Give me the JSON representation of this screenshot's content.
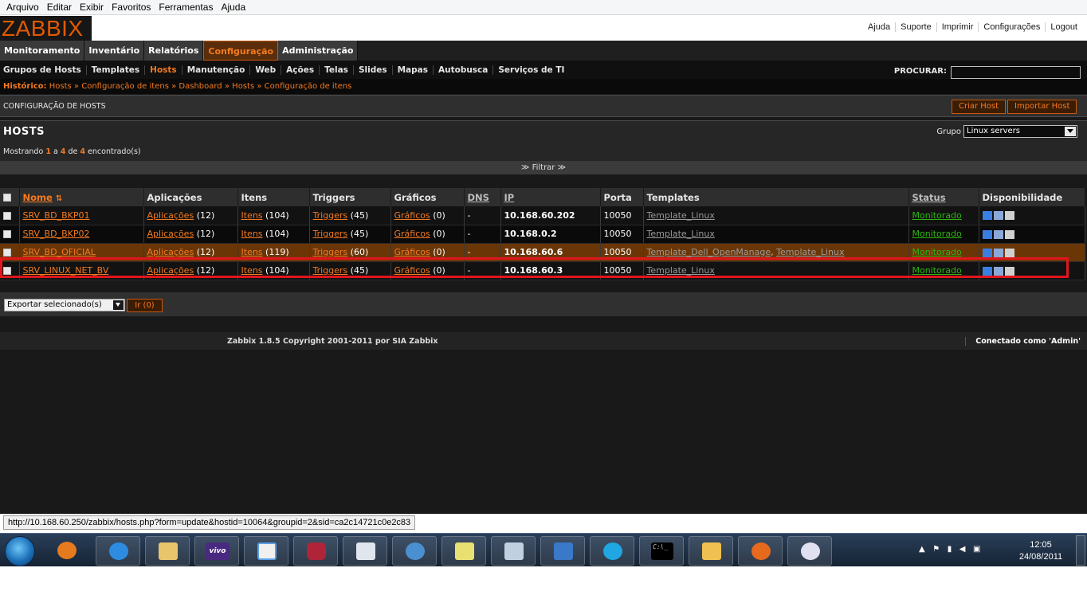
{
  "browser": {
    "menu": [
      "Arquivo",
      "Editar",
      "Exibir",
      "Favoritos",
      "Ferramentas",
      "Ajuda"
    ],
    "status_url": "http://10.168.60.250/zabbix/hosts.php?form=update&hostid=10064&groupid=2&sid=ca2c14721c0e2c83"
  },
  "header": {
    "logo": "ZABBIX",
    "links": [
      "Ajuda",
      "Suporte",
      "Imprimir",
      "Configurações",
      "Logout"
    ]
  },
  "main_menu": [
    {
      "label": "Monitoramento",
      "active": false
    },
    {
      "label": "Inventário",
      "active": false
    },
    {
      "label": "Relatórios",
      "active": false
    },
    {
      "label": "Configuração",
      "active": true
    },
    {
      "label": "Administração",
      "active": false
    }
  ],
  "sub_menu": [
    {
      "label": "Grupos de Hosts",
      "active": false
    },
    {
      "label": "Templates",
      "active": false
    },
    {
      "label": "Hosts",
      "active": true
    },
    {
      "label": "Manutenção",
      "active": false
    },
    {
      "label": "Web",
      "active": false
    },
    {
      "label": "Ações",
      "active": false
    },
    {
      "label": "Telas",
      "active": false
    },
    {
      "label": "Slides",
      "active": false
    },
    {
      "label": "Mapas",
      "active": false
    },
    {
      "label": "Autobusca",
      "active": false
    },
    {
      "label": "Serviços de TI",
      "active": false
    }
  ],
  "search": {
    "label": "PROCURAR:",
    "value": ""
  },
  "history": {
    "label": "Histórico:",
    "items": [
      "Hosts",
      "Configuração de itens",
      "Dashboard",
      "Hosts",
      "Configuração de itens"
    ],
    "separator": "»"
  },
  "section": {
    "title": "CONFIGURAÇÃO DE HOSTS",
    "create_button": "Criar Host",
    "import_button": "Importar Host"
  },
  "hosts_box": {
    "title": "HOSTS",
    "group_label": "Grupo",
    "group_value": "Linux servers",
    "count_prefix": "Mostrando",
    "count_from": "1",
    "count_a": "a",
    "count_to": "4",
    "count_de": "de",
    "count_total": "4",
    "count_suffix": "encontrado(s)",
    "filter_label": "≫ Filtrar ≫"
  },
  "table": {
    "columns": [
      "Nome",
      "Aplicações",
      "Itens",
      "Triggers",
      "Gráficos",
      "DNS",
      "IP",
      "Porta",
      "Templates",
      "Status",
      "Disponibilidade"
    ],
    "sort_icon": "sort-arrows-icon",
    "rows": [
      {
        "name": "SRV_BD_BKP01",
        "apps_label": "Aplicações",
        "apps": "(12)",
        "items_label": "Itens",
        "items": "(104)",
        "triggers_label": "Triggers",
        "triggers": "(45)",
        "graphs_label": "Gráficos",
        "graphs": "(0)",
        "dns": "-",
        "ip": "10.168.60.202",
        "port": "10050",
        "template1": "Template_Linux",
        "template2": "",
        "status": "Monitorado"
      },
      {
        "name": "SRV_BD_BKP02",
        "apps_label": "Aplicações",
        "apps": "(12)",
        "items_label": "Itens",
        "items": "(104)",
        "triggers_label": "Triggers",
        "triggers": "(45)",
        "graphs_label": "Gráficos",
        "graphs": "(0)",
        "dns": "-",
        "ip": "10.168.0.2",
        "port": "10050",
        "template1": "Template_Linux",
        "template2": "",
        "status": "Monitorado"
      },
      {
        "name": "SRV_BD_OFICIAL",
        "apps_label": "Aplicações",
        "apps": "(12)",
        "items_label": "Itens",
        "items": "(119)",
        "triggers_label": "Triggers",
        "triggers": "(60)",
        "graphs_label": "Gráficos",
        "graphs": "(0)",
        "dns": "-",
        "ip": "10.168.60.6",
        "port": "10050",
        "template1": "Template_Dell_OpenManage",
        "template2": "Template_Linux",
        "status": "Monitorado"
      },
      {
        "name": "SRV_LINUX_NET_BV",
        "apps_label": "Aplicações",
        "apps": "(12)",
        "items_label": "Itens",
        "items": "(104)",
        "triggers_label": "Triggers",
        "triggers": "(45)",
        "graphs_label": "Gráficos",
        "graphs": "(0)",
        "dns": "-",
        "ip": "10.168.60.3",
        "port": "10050",
        "template1": "Template_Linux",
        "template2": "",
        "status": "Monitorado"
      }
    ]
  },
  "bulk": {
    "select_value": "Exportar selecionado(s)",
    "go_button": "Ir (0)"
  },
  "footer": {
    "copyright": "Zabbix 1.8.5 Copyright 2001-2011 por SIA Zabbix",
    "connected": "Conectado como 'Admin'"
  },
  "taskbar": {
    "time": "12:05",
    "date": "24/08/2011",
    "app_icons": [
      "windows-start-icon",
      "media-player-icon",
      "internet-explorer-icon",
      "file-explorer-icon",
      "vivo-icon",
      "notepad-icon",
      "database-icon",
      "document-icon",
      "settings-icon",
      "sticky-notes-icon",
      "network-icon",
      "remote-desktop-icon",
      "skype-icon",
      "command-prompt-icon",
      "outlook-icon",
      "firefox-icon",
      "paint-icon"
    ],
    "vivo_label": "vivo",
    "cmd_label": "C:\\_"
  },
  "colors": {
    "accent": "#f47a20",
    "status_green": "#2db510",
    "highlight": "#e0161c"
  }
}
